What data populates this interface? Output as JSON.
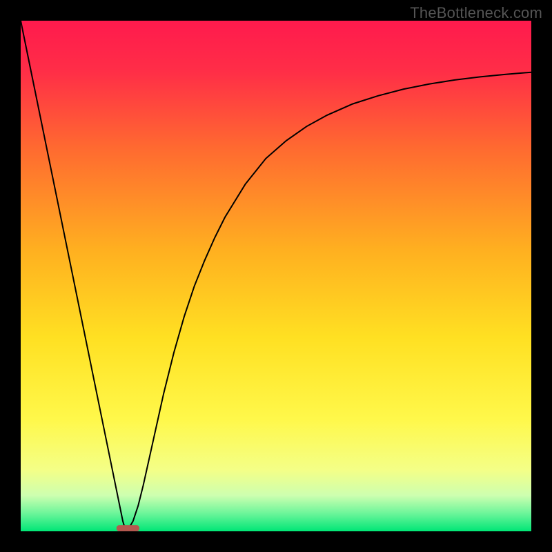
{
  "watermark": "TheBottleneck.com",
  "chart_data": {
    "type": "line",
    "title": "",
    "xlabel": "",
    "ylabel": "",
    "xlim": [
      0,
      100
    ],
    "ylim": [
      0,
      100
    ],
    "background_gradient": {
      "stops": [
        {
          "offset": 0.0,
          "color": "#ff1a4d"
        },
        {
          "offset": 0.1,
          "color": "#ff2e47"
        },
        {
          "offset": 0.25,
          "color": "#ff6a30"
        },
        {
          "offset": 0.45,
          "color": "#ffb020"
        },
        {
          "offset": 0.62,
          "color": "#ffe022"
        },
        {
          "offset": 0.78,
          "color": "#fff84a"
        },
        {
          "offset": 0.88,
          "color": "#f4ff87"
        },
        {
          "offset": 0.93,
          "color": "#cdffb0"
        },
        {
          "offset": 0.965,
          "color": "#6cf59a"
        },
        {
          "offset": 1.0,
          "color": "#00e676"
        }
      ]
    },
    "series": [
      {
        "name": "curve",
        "color": "#000000",
        "x": [
          0,
          2,
          4,
          6,
          8,
          10,
          12,
          14,
          16,
          18,
          20,
          20.5,
          21,
          22,
          23,
          24,
          25,
          26,
          27,
          28,
          30,
          32,
          34,
          36,
          38,
          40,
          44,
          48,
          52,
          56,
          60,
          65,
          70,
          75,
          80,
          85,
          90,
          95,
          100
        ],
        "y": [
          100,
          90.2,
          80.4,
          70.6,
          60.8,
          51.0,
          41.2,
          31.4,
          21.6,
          11.8,
          2.0,
          0.3,
          0.3,
          2.0,
          5.0,
          9.0,
          13.5,
          18.0,
          22.5,
          27.0,
          35.0,
          42.0,
          48.0,
          53.0,
          57.5,
          61.5,
          68.0,
          73.0,
          76.5,
          79.3,
          81.5,
          83.7,
          85.3,
          86.6,
          87.6,
          88.4,
          89.0,
          89.5,
          89.9
        ]
      }
    ],
    "optimal_marker": {
      "x": 21,
      "y": 0,
      "width": 4.5,
      "height": 1.2,
      "color": "#b4584f"
    }
  }
}
